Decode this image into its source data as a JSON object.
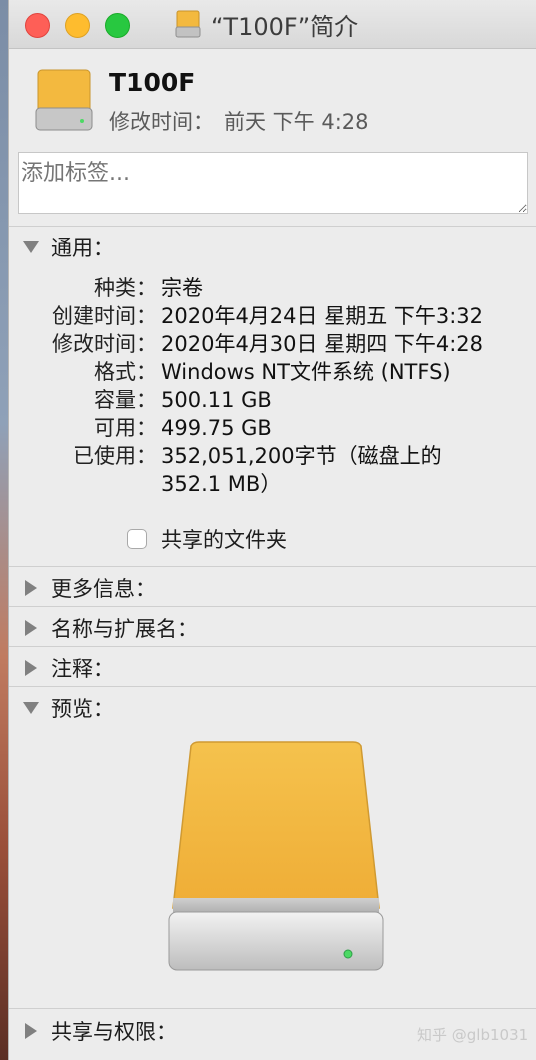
{
  "window": {
    "title": "“T100F”简介"
  },
  "header": {
    "name": "T100F",
    "modified_label": "修改时间：",
    "modified_value": "前天 下午 4:28"
  },
  "tags": {
    "placeholder": "添加标签..."
  },
  "sections": {
    "general": "通用：",
    "more_info": "更多信息：",
    "name_ext": "名称与扩展名：",
    "comments": "注释：",
    "preview": "预览：",
    "sharing": "共享与权限："
  },
  "general_info": [
    {
      "key": "种类：",
      "value": "宗卷"
    },
    {
      "key": "创建时间：",
      "value": "2020年4月24日 星期五 下午3:32"
    },
    {
      "key": "修改时间：",
      "value": "2020年4月30日 星期四 下午4:28"
    },
    {
      "key": "格式：",
      "value": "Windows NT文件系统 (NTFS)"
    },
    {
      "key": "容量：",
      "value": "500.11 GB"
    },
    {
      "key": "可用：",
      "value": "499.75 GB"
    },
    {
      "key": "已使用：",
      "value": "352,051,200字节（磁盘上的",
      "value2": "352.1 MB）"
    }
  ],
  "shared_folder": {
    "label": "共享的文件夹",
    "checked": false
  },
  "watermark": "知乎 @glb1031",
  "colors": {
    "drive_top": "#f3b93f",
    "drive_body": "#b9b9b9",
    "led": "#4cd964"
  },
  "icons": [
    "drive-icon"
  ]
}
